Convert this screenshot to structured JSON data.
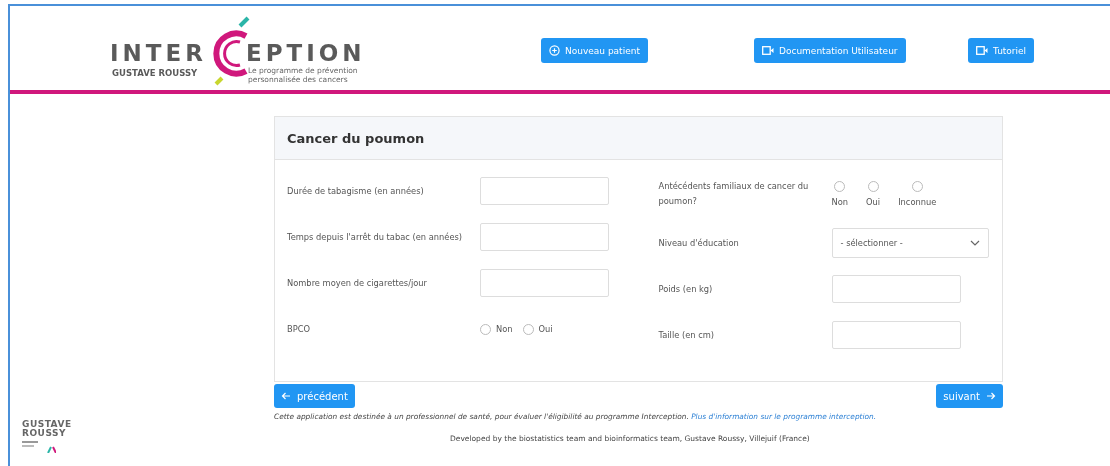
{
  "header": {
    "logo": {
      "left": "INTER",
      "right": "EPTION",
      "brand": "GUSTAVE ROUSSY",
      "tagline": "Le programme de prévention personnalisée des cancers"
    },
    "buttons": [
      {
        "label": "Nouveau patient",
        "kind": "add"
      },
      {
        "label": "Documentation Utilisateur",
        "kind": "video"
      },
      {
        "label": "Tutoriel",
        "kind": "video"
      }
    ]
  },
  "card": {
    "title": "Cancer du poumon",
    "left_fields": [
      {
        "kind": "text",
        "label": "Durée de tabagisme (en années)"
      },
      {
        "kind": "text",
        "label": "Temps depuis l'arrêt du tabac (en années)"
      },
      {
        "kind": "text",
        "label": "Nombre moyen de cigarettes/jour"
      },
      {
        "kind": "radio",
        "label": "BPCO",
        "options": [
          {
            "label": "Non",
            "checked": false
          },
          {
            "label": "Oui",
            "checked": false
          }
        ]
      }
    ],
    "right_fields": [
      {
        "kind": "radio_stacked",
        "label": "Antécédents familiaux de cancer du poumon?",
        "options": [
          {
            "label": "Non",
            "checked": false
          },
          {
            "label": "Oui",
            "checked": false
          },
          {
            "label": "Inconnue",
            "checked": false
          }
        ]
      },
      {
        "kind": "select",
        "label": "Niveau d'éducation",
        "value": "- sélectionner -"
      },
      {
        "kind": "text",
        "label": "Poids (en kg)"
      },
      {
        "kind": "text",
        "label": "Taille (en cm)"
      }
    ]
  },
  "nav": {
    "previous": "précédent",
    "next": "suivant"
  },
  "disclaimer": {
    "text": "Cette application est destinée à un professionnel de santé, pour évaluer l'éligibilité au programme Interception.",
    "link": "Plus d'information sur le programme interception."
  },
  "credits": "Developed by the biostatistics team and bioinformatics team, Gustave Roussy, Villejuif (France)",
  "footer_logo": {
    "line1": "GUSTAVE",
    "line2": "ROUSSY"
  }
}
